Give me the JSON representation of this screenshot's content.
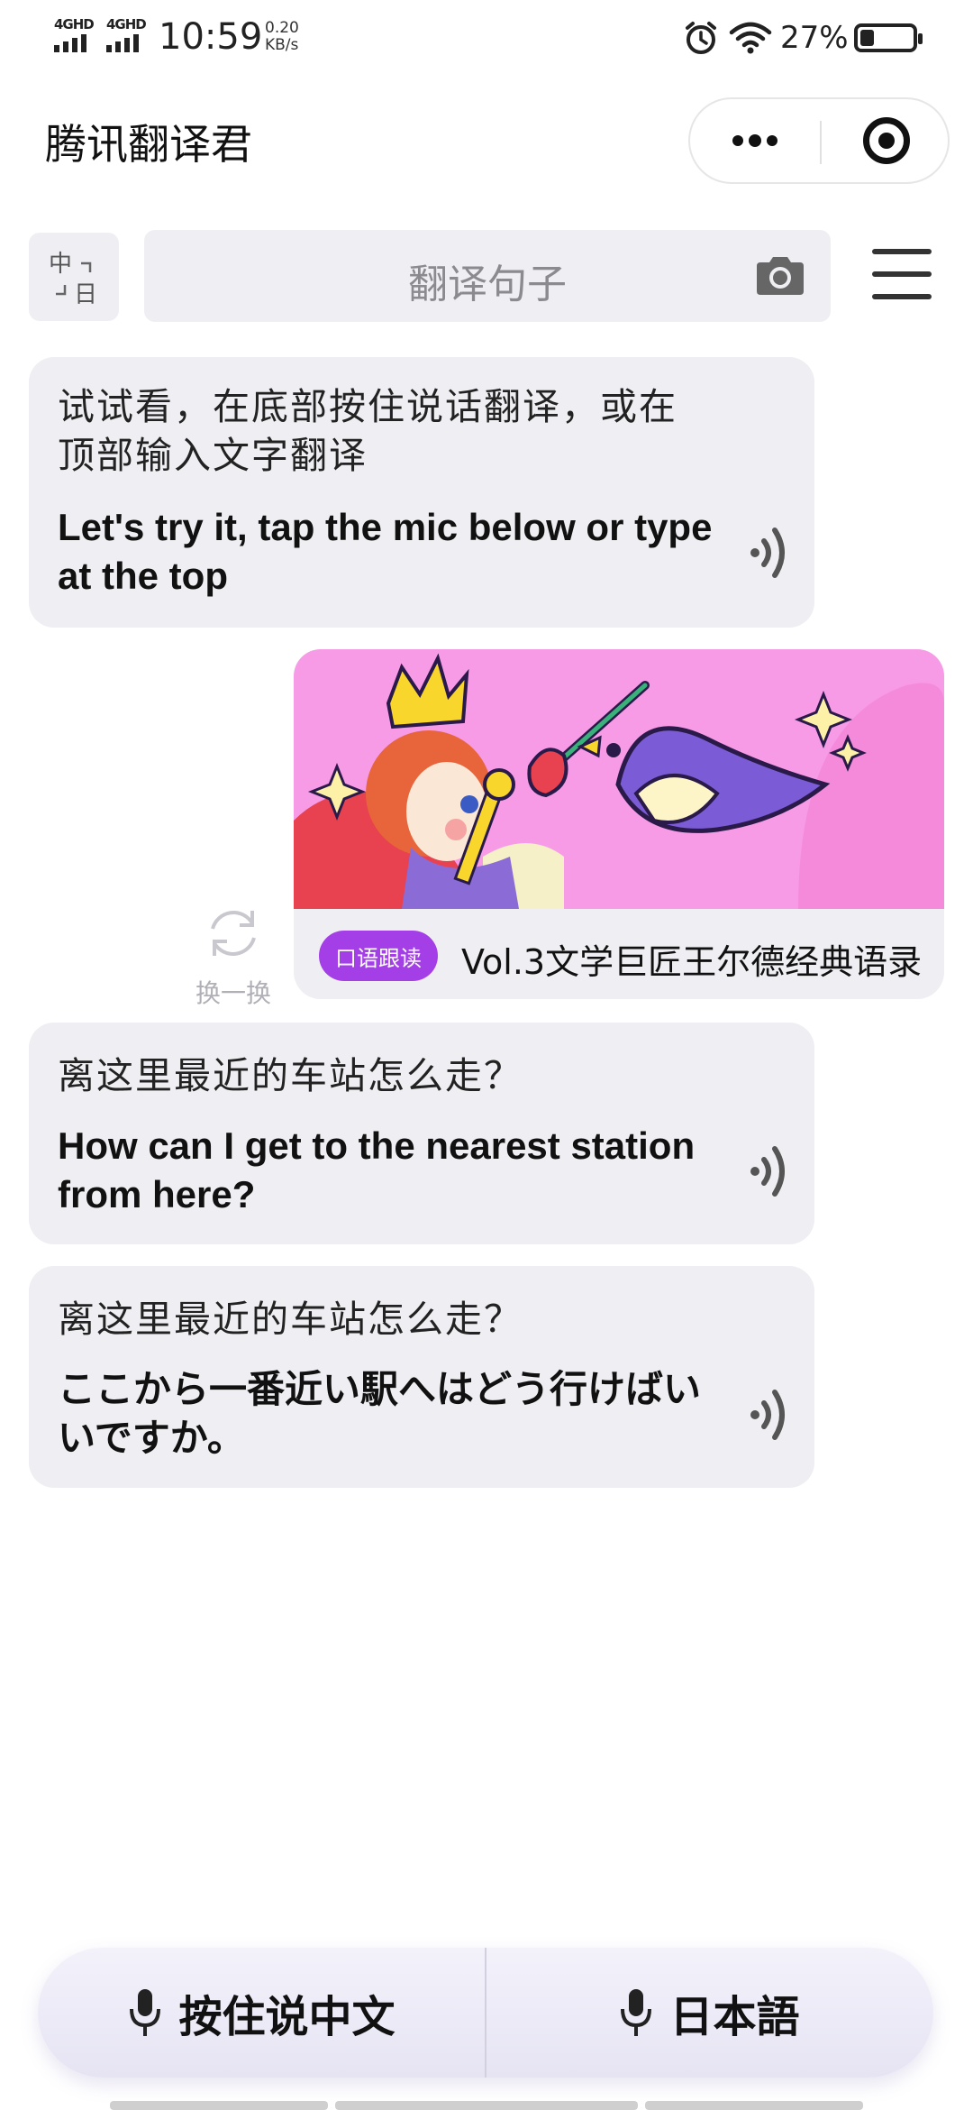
{
  "status_bar": {
    "network1": "4GHD",
    "network2": "4GHD",
    "time": "10:59",
    "speed_value": "0.20",
    "speed_unit": "KB/s",
    "battery": "27%",
    "battery_level": 0.27
  },
  "app_bar": {
    "title": "腾讯翻译君",
    "more_icon": "more-dots-icon",
    "close_icon": "target-close-icon"
  },
  "search": {
    "lang_top": "中",
    "lang_bottom": "日",
    "placeholder": "翻译句子",
    "camera_icon": "camera-icon",
    "menu_icon": "hamburger-menu-icon"
  },
  "cards": [
    {
      "source": "试试看，在底部按住说话翻译，或在顶部输入文字翻译",
      "target": "Let's try it, tap the mic below or type at the top"
    },
    {
      "source": "离这里最近的车站怎么走？",
      "target": "How can I get to the nearest station from here?"
    },
    {
      "source": "离这里最近的车站怎么走？",
      "target": "ここから一番近い駅へはどう行けばいいですか。"
    }
  ],
  "promo": {
    "tag": "口语跟读",
    "title": "Vol.3文学巨匠王尔德经典语录",
    "tag_color": "#a43fe8"
  },
  "refresh": {
    "label": "换一换"
  },
  "bottom_bar": {
    "left_label": "按住说中文",
    "right_label": "日本語",
    "mic_icon": "microphone-icon"
  },
  "colors": {
    "card_bg": "#efeff3",
    "accent_purple": "#a43fe8",
    "banner_pink": "#f79be6"
  }
}
